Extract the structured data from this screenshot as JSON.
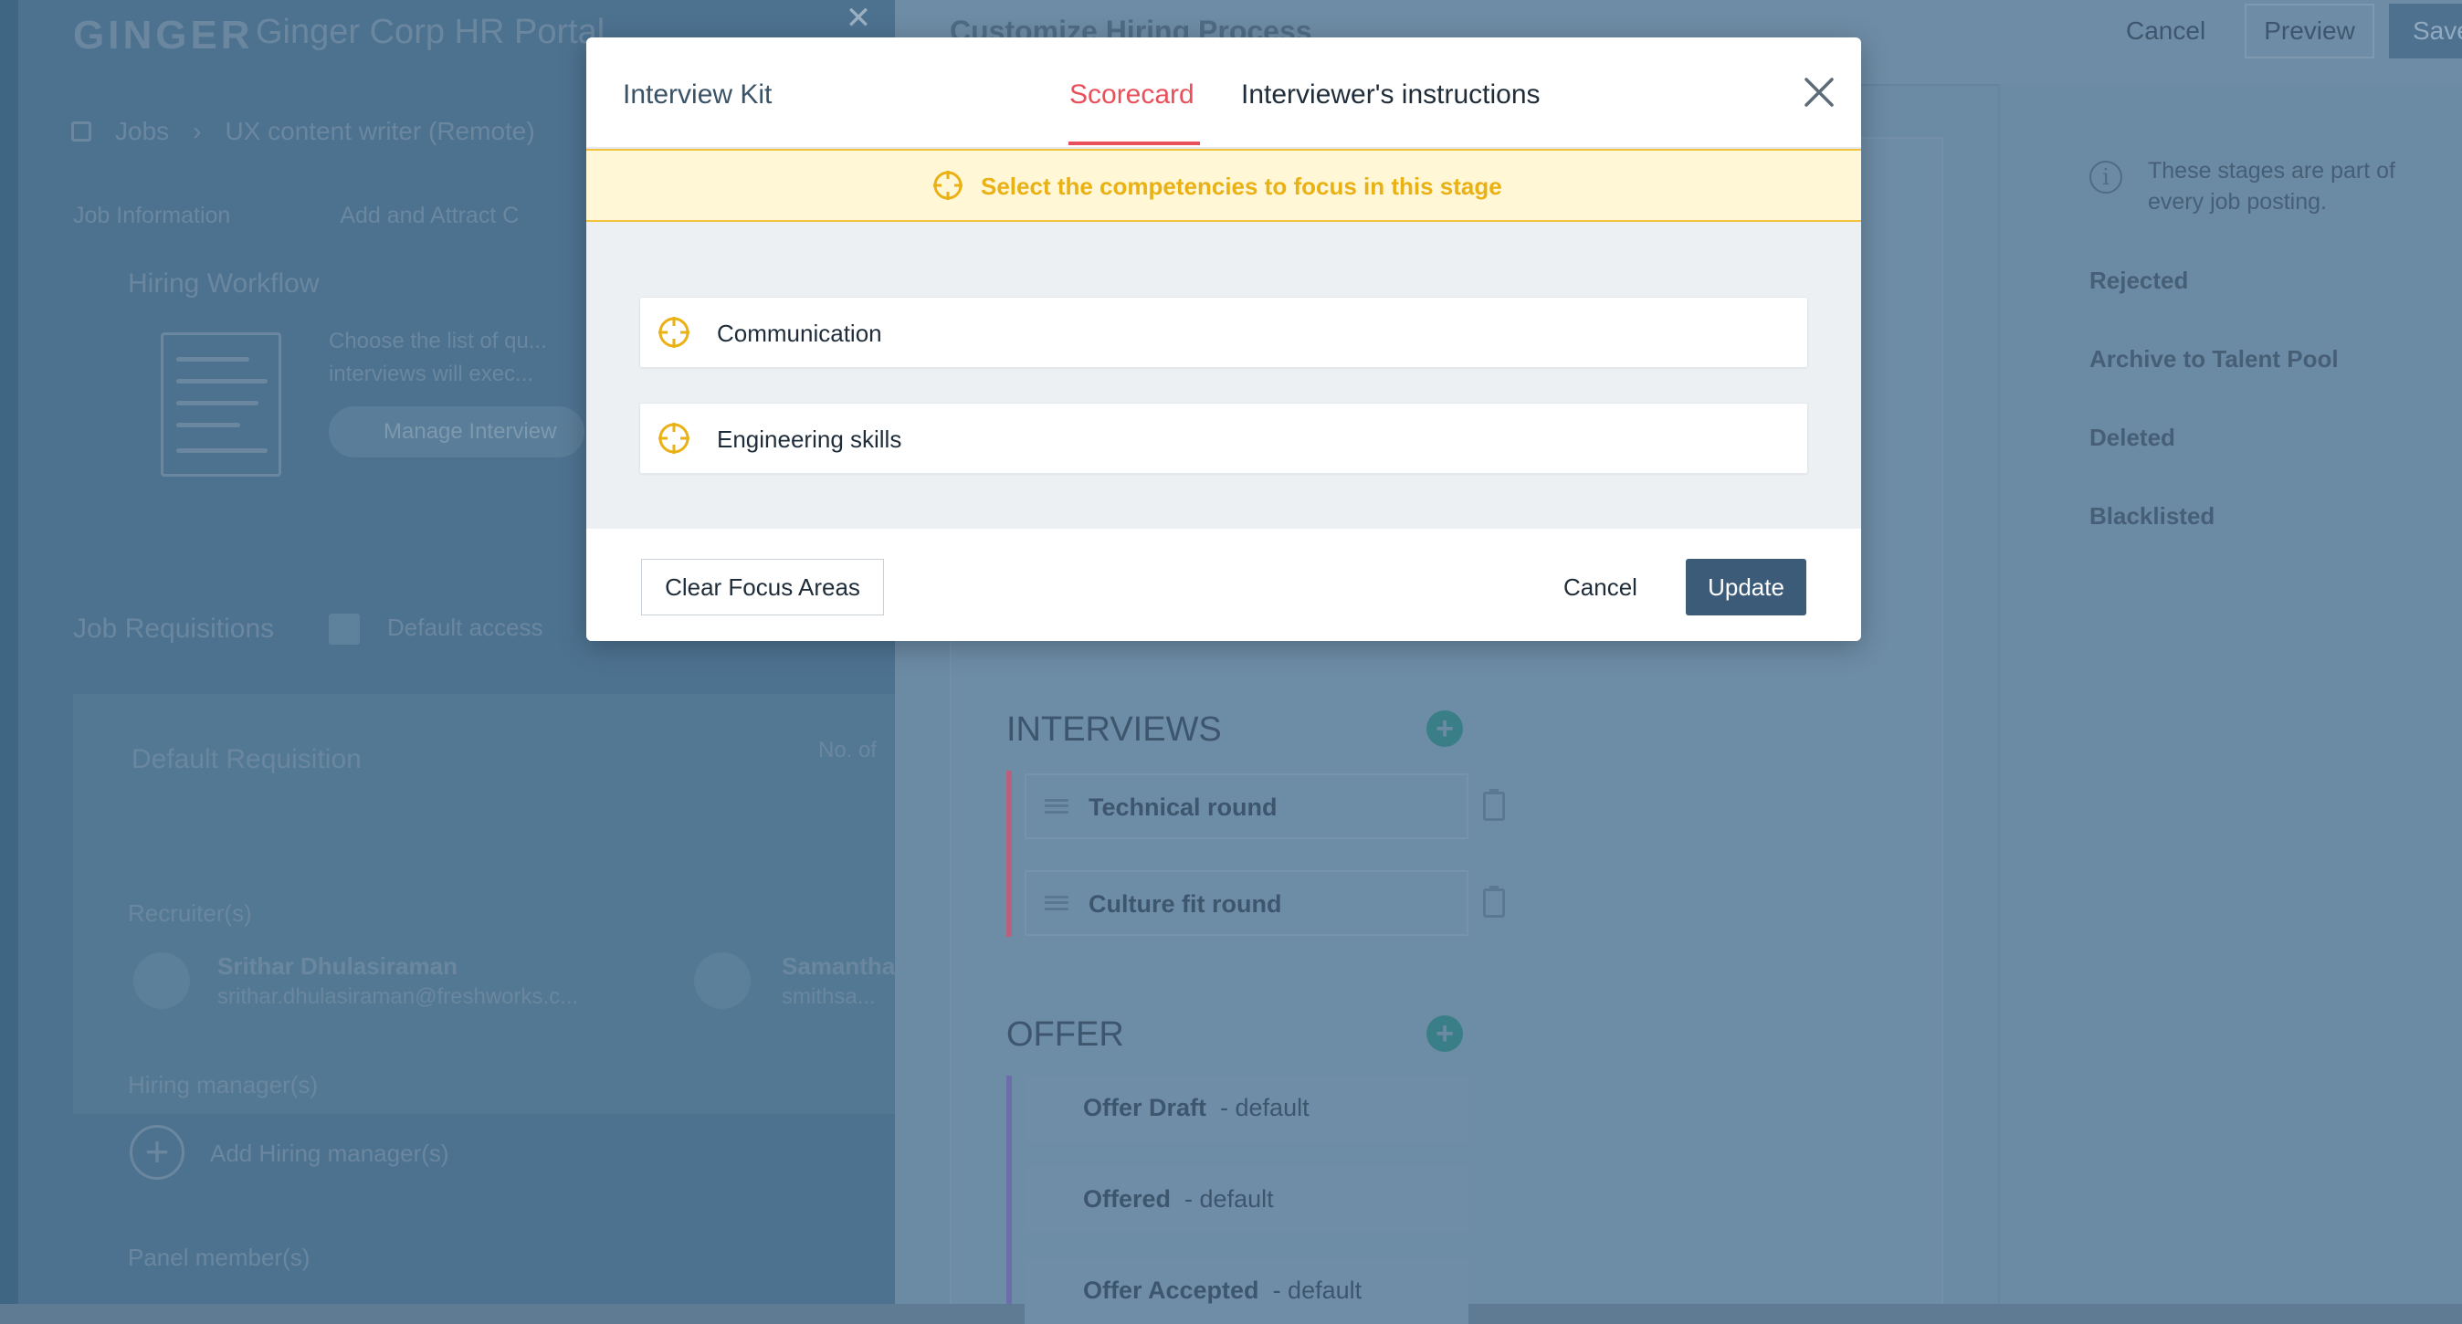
{
  "background": {
    "brand": "GINGER",
    "portal_title": "Ginger Corp HR Portal",
    "breadcrumb": {
      "root": "Jobs",
      "current": "UX content writer (Remote)"
    },
    "job_tabs": [
      "Job Information",
      "Add and Attract C"
    ],
    "workflow": {
      "title": "Hiring Workflow",
      "description": "Choose the list of qu... interviews will exec...",
      "manage_button": "Manage Interview"
    },
    "requisitions": {
      "title": "Job Requisitions",
      "access": "Default access",
      "name": "Default Requisition",
      "no_label": "No. of",
      "recruiters_label": "Recruiter(s)",
      "recruiter1_name": "Srithar Dhulasiraman",
      "recruiter1_email": "srithar.dhulasiraman@freshworks.c...",
      "recruiter2_name": "Samantha",
      "recruiter2_email": "smithsa...",
      "hiring_managers_label": "Hiring manager(s)",
      "add_hiring_manager": "Add Hiring manager(s)",
      "panel_members_label": "Panel member(s)"
    },
    "customize": {
      "title": "Customize Hiring Process",
      "cancel": "Cancel",
      "preview": "Preview",
      "save": "Save"
    },
    "info_text": "These stages are part of every job posting.",
    "system_stages": [
      "Rejected",
      "Archive to Talent Pool",
      "Deleted",
      "Blacklisted"
    ],
    "interviews": {
      "title": "INTERVIEWS",
      "stages": [
        "Technical round",
        "Culture fit round"
      ]
    },
    "offer": {
      "title": "OFFER",
      "default_suffix": "- default",
      "stages": [
        "Offer Draft",
        "Offered",
        "Offer Accepted"
      ]
    }
  },
  "modal": {
    "title": "Interview Kit",
    "tabs": {
      "scorecard": "Scorecard",
      "instructions": "Interviewer's instructions"
    },
    "banner": "Select the competencies to focus in this stage",
    "competencies": [
      "Communication",
      "Engineering skills"
    ],
    "clear_button": "Clear Focus Areas",
    "cancel_button": "Cancel",
    "update_button": "Update"
  },
  "colors": {
    "accent": "#e8505b",
    "banner_text": "#eab114",
    "primary_button": "#3b5b78",
    "interview_bar": "#b8607e",
    "offer_bar": "#6b6ea8"
  }
}
